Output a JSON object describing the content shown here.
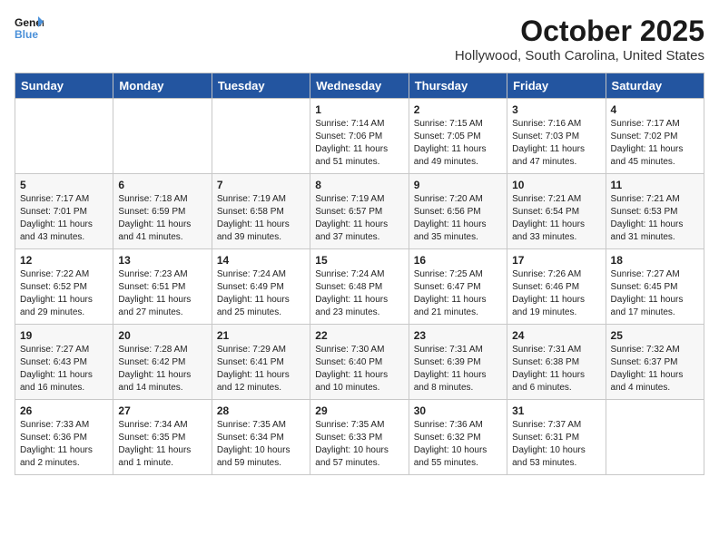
{
  "header": {
    "logo_line1": "General",
    "logo_line2": "Blue",
    "title": "October 2025",
    "subtitle": "Hollywood, South Carolina, United States"
  },
  "weekdays": [
    "Sunday",
    "Monday",
    "Tuesday",
    "Wednesday",
    "Thursday",
    "Friday",
    "Saturday"
  ],
  "weeks": [
    [
      {
        "day": "",
        "text": ""
      },
      {
        "day": "",
        "text": ""
      },
      {
        "day": "",
        "text": ""
      },
      {
        "day": "1",
        "text": "Sunrise: 7:14 AM\nSunset: 7:06 PM\nDaylight: 11 hours\nand 51 minutes."
      },
      {
        "day": "2",
        "text": "Sunrise: 7:15 AM\nSunset: 7:05 PM\nDaylight: 11 hours\nand 49 minutes."
      },
      {
        "day": "3",
        "text": "Sunrise: 7:16 AM\nSunset: 7:03 PM\nDaylight: 11 hours\nand 47 minutes."
      },
      {
        "day": "4",
        "text": "Sunrise: 7:17 AM\nSunset: 7:02 PM\nDaylight: 11 hours\nand 45 minutes."
      }
    ],
    [
      {
        "day": "5",
        "text": "Sunrise: 7:17 AM\nSunset: 7:01 PM\nDaylight: 11 hours\nand 43 minutes."
      },
      {
        "day": "6",
        "text": "Sunrise: 7:18 AM\nSunset: 6:59 PM\nDaylight: 11 hours\nand 41 minutes."
      },
      {
        "day": "7",
        "text": "Sunrise: 7:19 AM\nSunset: 6:58 PM\nDaylight: 11 hours\nand 39 minutes."
      },
      {
        "day": "8",
        "text": "Sunrise: 7:19 AM\nSunset: 6:57 PM\nDaylight: 11 hours\nand 37 minutes."
      },
      {
        "day": "9",
        "text": "Sunrise: 7:20 AM\nSunset: 6:56 PM\nDaylight: 11 hours\nand 35 minutes."
      },
      {
        "day": "10",
        "text": "Sunrise: 7:21 AM\nSunset: 6:54 PM\nDaylight: 11 hours\nand 33 minutes."
      },
      {
        "day": "11",
        "text": "Sunrise: 7:21 AM\nSunset: 6:53 PM\nDaylight: 11 hours\nand 31 minutes."
      }
    ],
    [
      {
        "day": "12",
        "text": "Sunrise: 7:22 AM\nSunset: 6:52 PM\nDaylight: 11 hours\nand 29 minutes."
      },
      {
        "day": "13",
        "text": "Sunrise: 7:23 AM\nSunset: 6:51 PM\nDaylight: 11 hours\nand 27 minutes."
      },
      {
        "day": "14",
        "text": "Sunrise: 7:24 AM\nSunset: 6:49 PM\nDaylight: 11 hours\nand 25 minutes."
      },
      {
        "day": "15",
        "text": "Sunrise: 7:24 AM\nSunset: 6:48 PM\nDaylight: 11 hours\nand 23 minutes."
      },
      {
        "day": "16",
        "text": "Sunrise: 7:25 AM\nSunset: 6:47 PM\nDaylight: 11 hours\nand 21 minutes."
      },
      {
        "day": "17",
        "text": "Sunrise: 7:26 AM\nSunset: 6:46 PM\nDaylight: 11 hours\nand 19 minutes."
      },
      {
        "day": "18",
        "text": "Sunrise: 7:27 AM\nSunset: 6:45 PM\nDaylight: 11 hours\nand 17 minutes."
      }
    ],
    [
      {
        "day": "19",
        "text": "Sunrise: 7:27 AM\nSunset: 6:43 PM\nDaylight: 11 hours\nand 16 minutes."
      },
      {
        "day": "20",
        "text": "Sunrise: 7:28 AM\nSunset: 6:42 PM\nDaylight: 11 hours\nand 14 minutes."
      },
      {
        "day": "21",
        "text": "Sunrise: 7:29 AM\nSunset: 6:41 PM\nDaylight: 11 hours\nand 12 minutes."
      },
      {
        "day": "22",
        "text": "Sunrise: 7:30 AM\nSunset: 6:40 PM\nDaylight: 11 hours\nand 10 minutes."
      },
      {
        "day": "23",
        "text": "Sunrise: 7:31 AM\nSunset: 6:39 PM\nDaylight: 11 hours\nand 8 minutes."
      },
      {
        "day": "24",
        "text": "Sunrise: 7:31 AM\nSunset: 6:38 PM\nDaylight: 11 hours\nand 6 minutes."
      },
      {
        "day": "25",
        "text": "Sunrise: 7:32 AM\nSunset: 6:37 PM\nDaylight: 11 hours\nand 4 minutes."
      }
    ],
    [
      {
        "day": "26",
        "text": "Sunrise: 7:33 AM\nSunset: 6:36 PM\nDaylight: 11 hours\nand 2 minutes."
      },
      {
        "day": "27",
        "text": "Sunrise: 7:34 AM\nSunset: 6:35 PM\nDaylight: 11 hours\nand 1 minute."
      },
      {
        "day": "28",
        "text": "Sunrise: 7:35 AM\nSunset: 6:34 PM\nDaylight: 10 hours\nand 59 minutes."
      },
      {
        "day": "29",
        "text": "Sunrise: 7:35 AM\nSunset: 6:33 PM\nDaylight: 10 hours\nand 57 minutes."
      },
      {
        "day": "30",
        "text": "Sunrise: 7:36 AM\nSunset: 6:32 PM\nDaylight: 10 hours\nand 55 minutes."
      },
      {
        "day": "31",
        "text": "Sunrise: 7:37 AM\nSunset: 6:31 PM\nDaylight: 10 hours\nand 53 minutes."
      },
      {
        "day": "",
        "text": ""
      }
    ]
  ]
}
